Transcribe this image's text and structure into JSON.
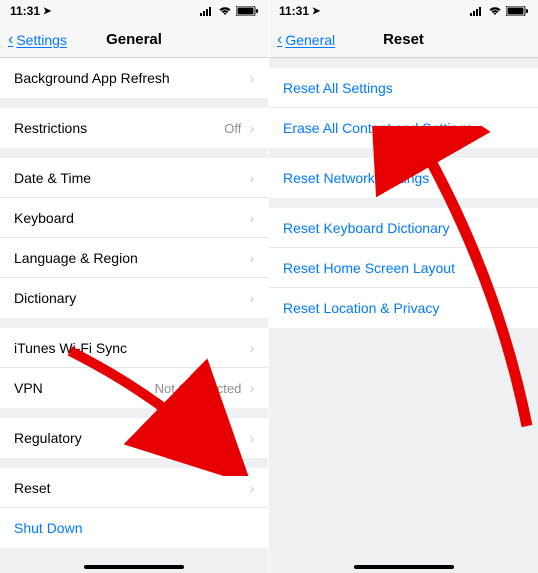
{
  "left": {
    "status": {
      "time": "11:31"
    },
    "nav": {
      "back": "Settings",
      "title": "General"
    },
    "rows": {
      "bg_refresh": "Background App Refresh",
      "restrictions": "Restrictions",
      "restrictions_value": "Off",
      "date_time": "Date & Time",
      "keyboard": "Keyboard",
      "language_region": "Language & Region",
      "dictionary": "Dictionary",
      "itunes_wifi": "iTunes Wi-Fi Sync",
      "vpn": "VPN",
      "vpn_value": "Not Connected",
      "regulatory": "Regulatory",
      "reset": "Reset",
      "shutdown": "Shut Down"
    }
  },
  "right": {
    "status": {
      "time": "11:31"
    },
    "nav": {
      "back": "General",
      "title": "Reset"
    },
    "rows": {
      "reset_all": "Reset All Settings",
      "erase_all": "Erase All Content and Settings",
      "reset_network": "Reset Network Settings",
      "reset_keyboard": "Reset Keyboard Dictionary",
      "reset_home": "Reset Home Screen Layout",
      "reset_location": "Reset Location & Privacy"
    }
  }
}
